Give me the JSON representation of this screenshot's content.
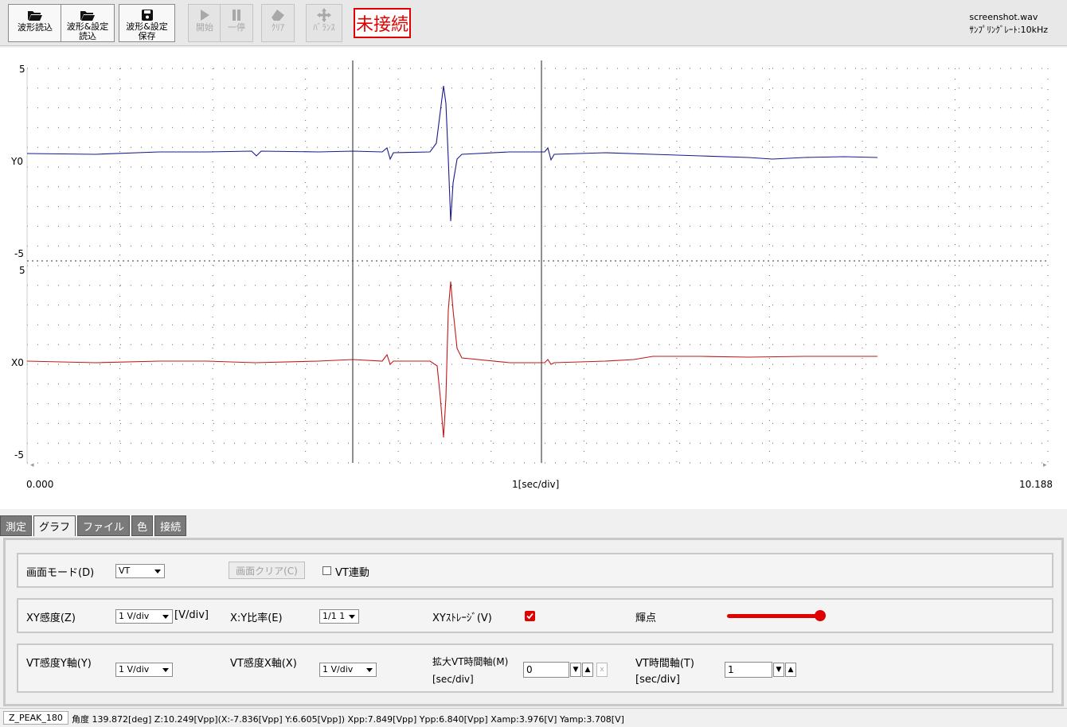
{
  "toolbar": {
    "buttons": [
      {
        "label": "波形読込",
        "icon": "folder-open-icon"
      },
      {
        "label": "波形&設定\n読込",
        "icon": "folder-open-icon"
      },
      {
        "label": "波形&設定\n保存",
        "icon": "save-icon"
      },
      {
        "label": "開始",
        "icon": "play-icon"
      },
      {
        "label": "一停",
        "icon": "pause-icon"
      },
      {
        "label": "ｸﾘｱ",
        "icon": "eraser-icon"
      },
      {
        "label": "ﾊﾞﾗﾝｽ",
        "icon": "move-icon"
      }
    ],
    "connection_status": "未接続",
    "filename": "screenshot.wav",
    "sample_rate": "ｻﾝﾌﾟﾘﾝｸﾞﾚｰﾄ:10kHz"
  },
  "plot": {
    "top_channel": {
      "max_label": "5",
      "zero_label": "Y0",
      "min_label": "-5",
      "color": "#1a1a8c"
    },
    "bottom_channel": {
      "max_label": "5",
      "zero_label": "X0",
      "min_label": "-5",
      "color": "#c01818"
    },
    "x_start": "0.000",
    "x_div": "1[sec/div]",
    "x_end": "10.188"
  },
  "tabs": [
    "測定",
    "グラフ",
    "ファイル",
    "色",
    "接続"
  ],
  "active_tab": "グラフ",
  "panel": {
    "row1": {
      "mode_label": "画面モード(D)",
      "mode_value": "VT",
      "clear_button": "画面クリア(C)",
      "vt_link": "VT連動"
    },
    "row2": {
      "xy_sens_label": "XY感度(Z)",
      "xy_sens_value": "1 V/div",
      "xy_sens_unit": "[V/div]",
      "ratio_label": "X:Y比率(E)",
      "ratio_value": "1/1 1",
      "storage_label": "XYｽﾄﾚｰｼﾞ(V)",
      "bright_label": "輝点",
      "bright_color": "#e00000"
    },
    "row3": {
      "vt_y_label": "VT感度Y軸(Y)",
      "vt_y_value": "1 V/div",
      "vt_x_label": "VT感度X軸(X)",
      "vt_x_value": "1 V/div",
      "zoom_label": "拡大VT時間軸(M)",
      "zoom_unit": "[sec/div]",
      "zoom_value": "0",
      "time_label": "VT時間軸(T)",
      "time_unit": "[sec/div]",
      "time_value": "1"
    }
  },
  "statusbar": {
    "mode": "Z_PEAK_180",
    "readout": "角度 139.872[deg] Z:10.249[Vpp](X:-7.836[Vpp] Y:6.605[Vpp]) Xpp:7.849[Vpp] Ypp:6.840[Vpp] Xamp:3.976[V] Yamp:3.708[V]"
  }
}
